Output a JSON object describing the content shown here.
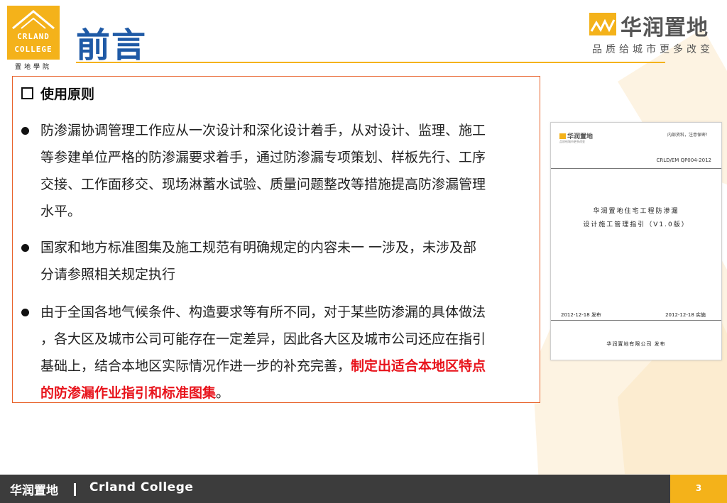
{
  "header": {
    "logo_line1": "CRLAND",
    "logo_line2": "COLLEGE",
    "logo_sub": "置地學院",
    "title": "前言",
    "brand_name": "华润置地",
    "brand_slogan": "品质给城市更多改变"
  },
  "content": {
    "section_heading": "使用原则",
    "bullets": [
      {
        "line1": "防渗漏协调管理工作应从一次设计和深化设计着手，从对设计、监理、施工",
        "line2": "等参建单位严格的防渗漏要求着手，通过防渗漏专项策划、样板先行、工序",
        "line3": "交接、工作面移交、现场淋蓄水试验、质量问题整改等措施提高防渗漏管理",
        "line4": "水平。"
      },
      {
        "line1": "国家和地方标准图集及施工规范有明确规定的内容未一 一涉及，未涉及部",
        "line2": "分请参照相关规定执行"
      },
      {
        "line1": "由于全国各地气候条件、构造要求等有所不同，对于某些防渗漏的具体做法",
        "line2": "，各大区及城市公司可能存在一定差异，因此各大区及城市公司还应在指引",
        "line3_normal": "基础上，结合本地区实际情况作进一步的补充完善，",
        "line3_highlight": "制定出适合本地区特点",
        "line4_highlight": "的防渗漏作业指引和标准图集",
        "line4_end": "。"
      }
    ]
  },
  "document_image": {
    "logo": "华润置地",
    "logo_sub": "品质给城市更多改变",
    "note": "内部资料，注意保密！",
    "code": "CRLD/EM QP004-2012",
    "title_line1": "华润置地住宅工程防渗漏",
    "title_line2": "设计施工管理指引（V1.0版）",
    "date_issue": "2012-12-18  发布",
    "date_effective": "2012-12-18  实施",
    "company": "华润置地有限公司  发布"
  },
  "footer": {
    "company": "华润置地",
    "college": "Crland  College",
    "page_number": "3"
  },
  "colors": {
    "accent_gold": "#f4b21a",
    "title_blue": "#1f5aa6",
    "border_orange": "#e8622a",
    "highlight_red": "#e8141c",
    "footer_dark": "#3c3c3c"
  }
}
